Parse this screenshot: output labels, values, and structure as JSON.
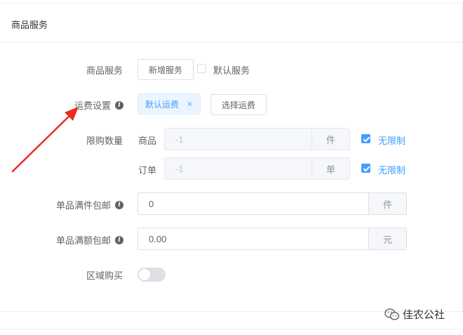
{
  "card": {
    "title": "商品服务"
  },
  "service": {
    "label": "商品服务",
    "add_button": "新增服务",
    "default_checkbox_label": "默认服务",
    "default_checked": false
  },
  "shipping": {
    "label": "运费设置",
    "selected_tag": "默认运费",
    "tag_close": "×",
    "select_button": "选择运费"
  },
  "purchase_limit": {
    "label": "限购数量",
    "product": {
      "label": "商品",
      "value": "-1",
      "unit": "件",
      "unlimited_label": "无限制",
      "unlimited_checked": true
    },
    "order": {
      "label": "订单",
      "value": "-1",
      "unit": "单",
      "unlimited_label": "无限制",
      "unlimited_checked": true
    }
  },
  "free_ship_qty": {
    "label": "单品满件包邮",
    "value": "0",
    "unit": "件"
  },
  "free_ship_amount": {
    "label": "单品满额包邮",
    "value": "0.00",
    "unit": "元"
  },
  "region_purchase": {
    "label": "区域购买",
    "enabled": false
  },
  "watermark": {
    "text": "佳农公社"
  },
  "colors": {
    "primary": "#409eff",
    "arrow": "#ee2a1e"
  }
}
